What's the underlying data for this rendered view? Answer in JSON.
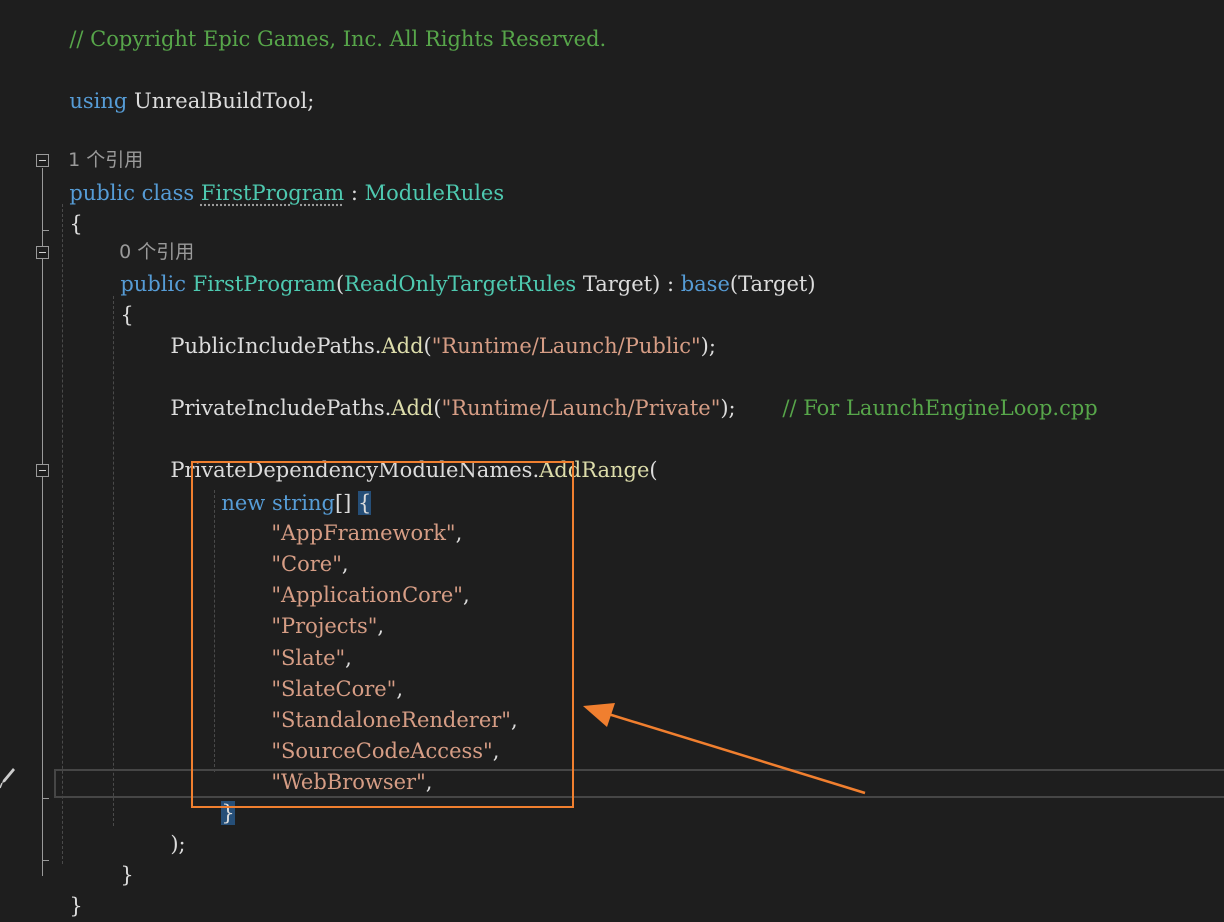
{
  "code": {
    "copyright_comment": "// Copyright Epic Games, Inc. All Rights Reserved.",
    "using_kw": "using",
    "using_ns": "UnrealBuildTool",
    "using_semicolon": ";",
    "ref_count_class": "1 个引用",
    "class_public": "public",
    "class_kw": "class",
    "class_name": "FirstProgram",
    "class_colon": " : ",
    "base_type": "ModuleRules",
    "open_brace_class": "{",
    "ref_count_ctor": "0 个引用",
    "ctor_public": "public",
    "ctor_name": "FirstProgram",
    "ctor_paren_open": "(",
    "ctor_param_type": "ReadOnlyTargetRules",
    "ctor_param_name": " Target",
    "ctor_paren_close": ") : ",
    "base_kw": "base",
    "base_args": "(Target)",
    "open_brace_ctor": "{",
    "public_include_paths": "PublicIncludePaths",
    "dot_add": ".",
    "add_fn": "Add",
    "public_path_open": "(",
    "public_path": "\"Runtime/Launch/Public\"",
    "public_path_close": ");",
    "private_include_paths": "PrivateIncludePaths",
    "private_path_open": "(",
    "private_path": "\"Runtime/Launch/Private\"",
    "private_path_close": ");",
    "private_path_comment": "// For LaunchEngineLoop.cpp",
    "private_dep_names": "PrivateDependencyModuleNames",
    "add_range_fn": "AddRange",
    "add_range_open": "(",
    "new_kw": "new",
    "string_kw": "string",
    "array_brackets": "[]",
    "array_open_brace": "{",
    "modules": [
      "\"AppFramework\"",
      "\"Core\"",
      "\"ApplicationCore\"",
      "\"Projects\"",
      "\"Slate\"",
      "\"SlateCore\"",
      "\"StandaloneRenderer\"",
      "\"SourceCodeAccess\"",
      "\"WebBrowser\""
    ],
    "comma": ",",
    "array_close_brace": "}",
    "add_range_close": ");",
    "close_brace_ctor": "}",
    "close_brace_class": "}"
  },
  "colors": {
    "background": "#1e1e1e",
    "keyword": "#569cd6",
    "type": "#4ec9b0",
    "method": "#dcdcaa",
    "string": "#d69d85",
    "comment": "#57a64a",
    "annotation_box": "#f07f2f",
    "annotation_arrow": "#f07f2f"
  }
}
